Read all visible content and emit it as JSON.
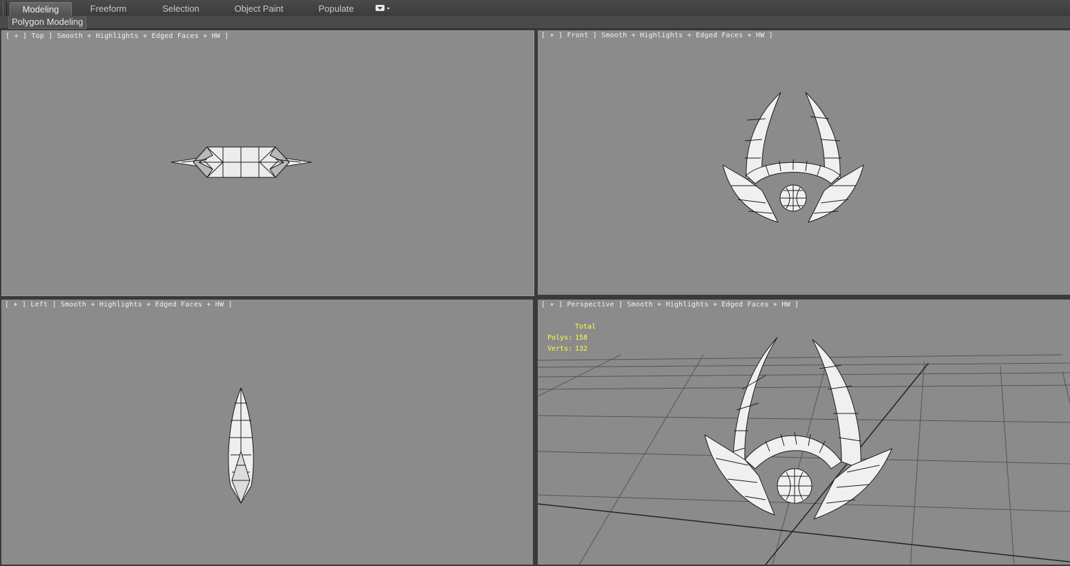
{
  "ribbon": {
    "tabs": [
      "Modeling",
      "Freeform",
      "Selection",
      "Object Paint",
      "Populate"
    ],
    "active_tab": "Modeling",
    "more_icon": "dropdown-arrow-icon"
  },
  "subbar": {
    "panel_label": "Polygon Modeling"
  },
  "viewports": {
    "top": {
      "label": "[ + ] Top ] Smooth + Highlights + Edged Faces + HW ]"
    },
    "front": {
      "label": "[ + ] Front ] Smooth + Highlights + Edged Faces + HW ]"
    },
    "left": {
      "label": "[ + ] Left ] Smooth + Highlights + Edged Faces + HW ]"
    },
    "perspective": {
      "label": "[ + ] Perspective ] Smooth + Highlights + Edged Faces + HW ]",
      "stats": {
        "title": "Total",
        "polys_label": "Polys:",
        "polys": "158",
        "verts_label": "Verts:",
        "verts": "132"
      }
    }
  },
  "colors": {
    "viewport_bg": "#8b8b8b",
    "stats_text": "#ffff40",
    "ribbon_bg": "#444444"
  }
}
